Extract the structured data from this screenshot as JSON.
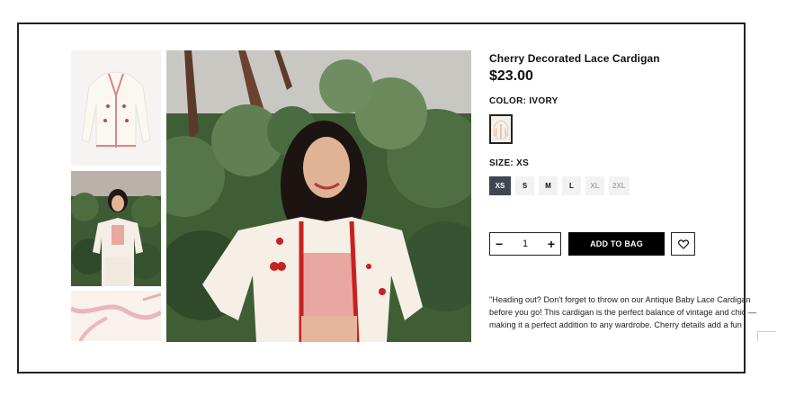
{
  "product": {
    "title": "Cherry Decorated Lace Cardigan",
    "price": "$23.00",
    "color_label": "COLOR: IVORY",
    "size_label": "SIZE: XS",
    "sizes": [
      {
        "label": "XS",
        "state": "selected"
      },
      {
        "label": "S",
        "state": "available"
      },
      {
        "label": "M",
        "state": "available"
      },
      {
        "label": "L",
        "state": "available"
      },
      {
        "label": "XL",
        "state": "unavailable"
      },
      {
        "label": "2XL",
        "state": "unavailable"
      }
    ],
    "quantity": "1",
    "add_to_bag_label": "ADD TO BAG",
    "description": "\"Heading out? Don't forget to throw on our Antique Baby Lace Cardigan before you go! This cardigan is the perfect balance of vintage and chic — making it a perfect addition to any wardrobe. Cherry details add a fun"
  },
  "icons": {
    "minus": "minus-icon",
    "plus": "plus-icon",
    "wishlist": "heart-icon"
  },
  "colors": {
    "selected_size_bg": "#3d4651",
    "button_bg": "#000000",
    "size_bg": "#f2f2f2",
    "cardigan": "#f5efe6",
    "trim": "#c8211f"
  }
}
